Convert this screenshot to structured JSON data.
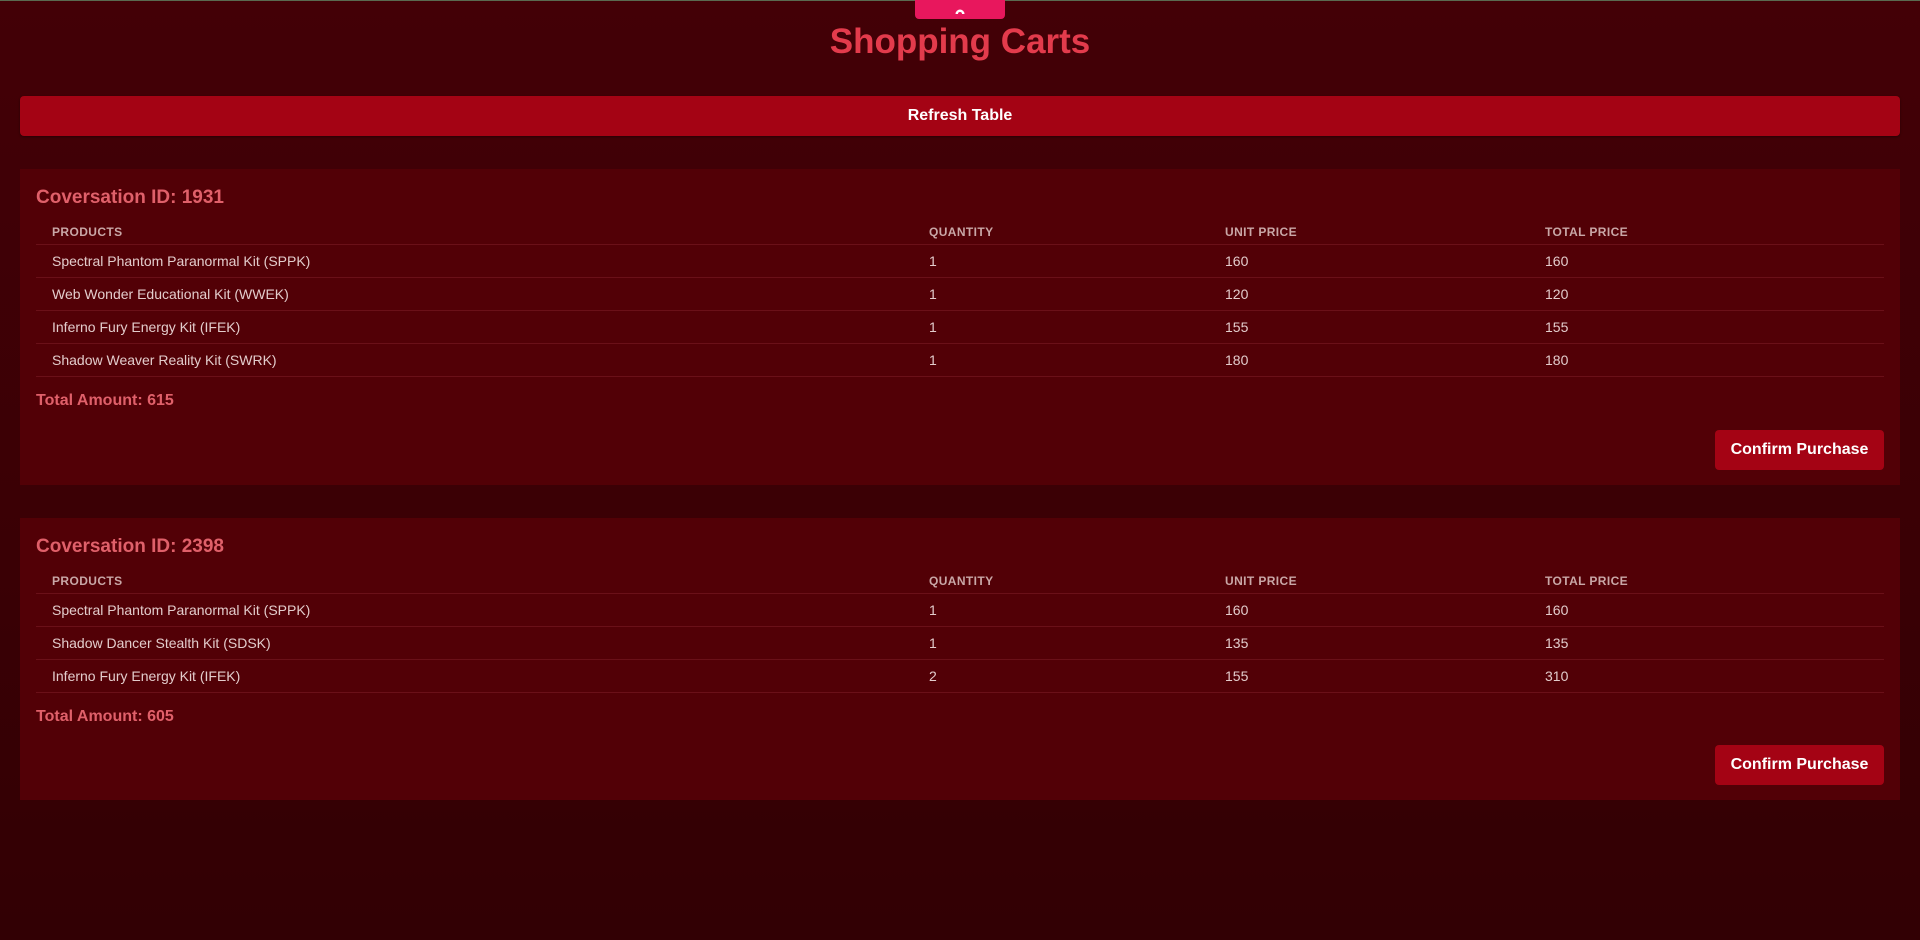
{
  "page": {
    "title": "Shopping Carts",
    "refresh_label": "Refresh Table"
  },
  "colors": {
    "background": "#3a0005",
    "accent": "#a40314",
    "title": "#e33b4c",
    "tab": "#e8175d",
    "card": "#520006"
  },
  "table_headers": {
    "products": "PRODUCTS",
    "quantity": "QUANTITY",
    "unit_price": "UNIT PRICE",
    "total_price": "TOTAL PRICE"
  },
  "carts": [
    {
      "title": "Coversation ID: 1931",
      "rows": [
        {
          "product": "Spectral Phantom Paranormal Kit (SPPK)",
          "quantity": "1",
          "unit_price": "160",
          "total_price": "160"
        },
        {
          "product": "Web Wonder Educational Kit (WWEK)",
          "quantity": "1",
          "unit_price": "120",
          "total_price": "120"
        },
        {
          "product": "Inferno Fury Energy Kit (IFEK)",
          "quantity": "1",
          "unit_price": "155",
          "total_price": "155"
        },
        {
          "product": "Shadow Weaver Reality Kit (SWRK)",
          "quantity": "1",
          "unit_price": "180",
          "total_price": "180"
        }
      ],
      "total": "Total Amount: 615",
      "confirm_label": "Confirm Purchase"
    },
    {
      "title": "Coversation ID: 2398",
      "rows": [
        {
          "product": "Spectral Phantom Paranormal Kit (SPPK)",
          "quantity": "1",
          "unit_price": "160",
          "total_price": "160"
        },
        {
          "product": "Shadow Dancer Stealth Kit (SDSK)",
          "quantity": "1",
          "unit_price": "135",
          "total_price": "135"
        },
        {
          "product": "Inferno Fury Energy Kit (IFEK)",
          "quantity": "2",
          "unit_price": "155",
          "total_price": "310"
        }
      ],
      "total": "Total Amount: 605",
      "confirm_label": "Confirm Purchase"
    }
  ]
}
